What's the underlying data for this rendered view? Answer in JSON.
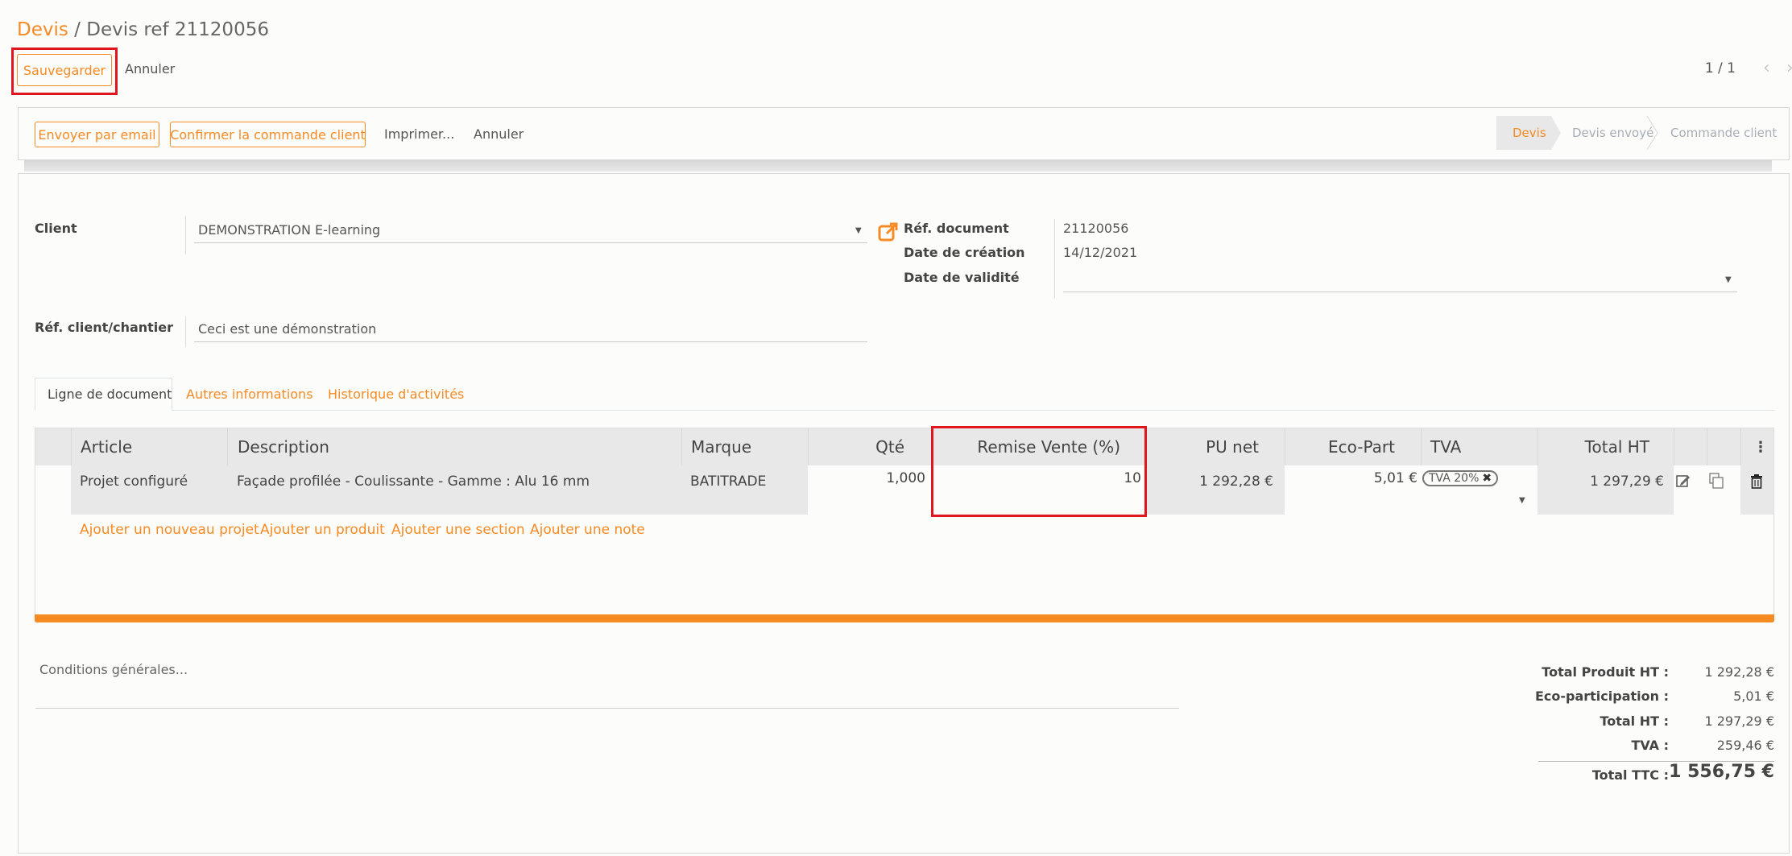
{
  "breadcrumb": {
    "parent": "Devis",
    "separator": " / ",
    "current": "Devis ref 21120056"
  },
  "control": {
    "save_label": "Sauvegarder",
    "discard_label": "Annuler",
    "pager": "1 / 1"
  },
  "actions": {
    "send_email": "Envoyer par email",
    "confirm_order": "Confirmer la commande client",
    "print": "Imprimer...",
    "cancel": "Annuler"
  },
  "statusbar": {
    "stages": [
      "Devis",
      "Devis envoyé",
      "Commande client"
    ],
    "active": "Devis"
  },
  "form": {
    "client_label": "Client",
    "client_value": "DEMONSTRATION E-learning",
    "ref_client_label": "Réf. client/chantier",
    "ref_client_value": "Ceci est une démonstration",
    "ref_doc_label": "Réf. document",
    "ref_doc_value": "21120056",
    "date_creation_label": "Date de création",
    "date_creation_value": "14/12/2021",
    "date_validite_label": "Date de validité",
    "date_validite_value": ""
  },
  "tabs": [
    {
      "label": "Ligne de document",
      "active": true
    },
    {
      "label": "Autres informations",
      "active": false
    },
    {
      "label": "Historique d'activités",
      "active": false
    }
  ],
  "table": {
    "headers": [
      "Article",
      "Description",
      "Marque",
      "Qté",
      "Remise Vente (%)",
      "PU net",
      "Eco-Part",
      "TVA",
      "Total HT"
    ],
    "rows": [
      {
        "article": "Projet configuré",
        "description": "Façade profilée - Coulissante - Gamme : Alu 16 mm",
        "marque": "BATITRADE",
        "qte": "1,000",
        "remise": "10",
        "pu_net": "1 292,28 €",
        "eco_part": "5,01 €",
        "tva": "TVA 20%",
        "total_ht": "1 297,29 €"
      }
    ],
    "add_links": [
      "Ajouter un nouveau projet",
      "Ajouter un produit",
      "Ajouter une section",
      "Ajouter une note"
    ]
  },
  "conditions_placeholder": "Conditions générales...",
  "totals": {
    "total_produit_ht_label": "Total Produit HT :",
    "total_produit_ht": "1 292,28 €",
    "eco_participation_label": "Eco-participation :",
    "eco_participation": "5,01 €",
    "total_ht_label": "Total HT :",
    "total_ht": "1 297,29 €",
    "tva_label": "TVA :",
    "tva": "259,46 €",
    "total_ttc_label": "Total TTC :",
    "total_ttc": "1 556,75 €"
  },
  "colors": {
    "accent": "#f68b24",
    "highlight": "#e0161e"
  }
}
